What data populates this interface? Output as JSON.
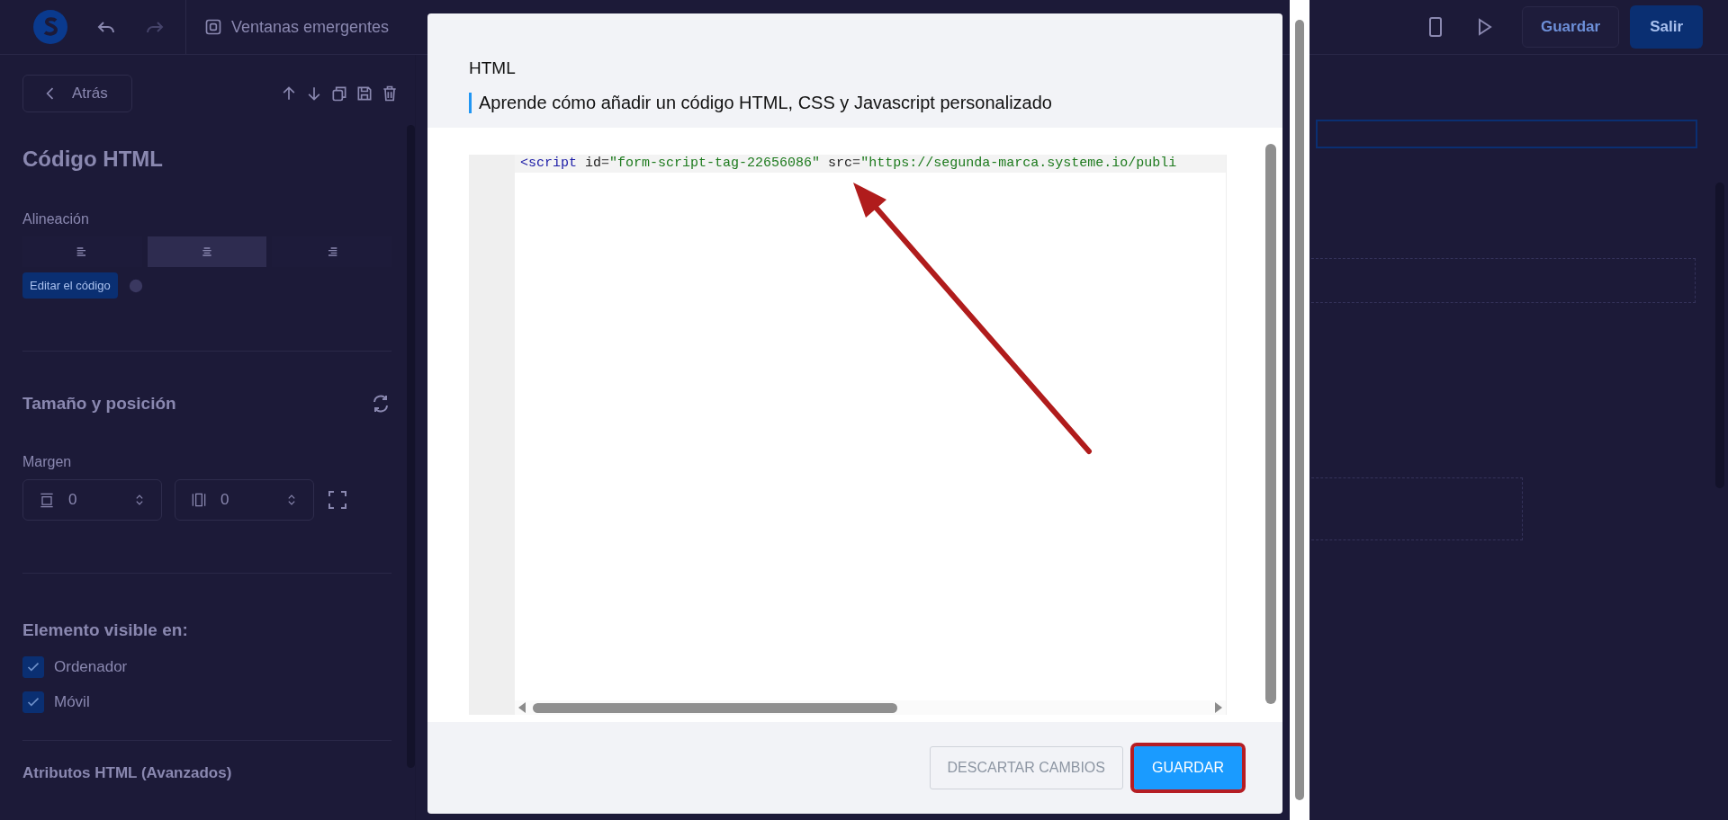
{
  "topbar": {
    "section": "Ventanas emergentes",
    "save": "Guardar",
    "exit": "Salir"
  },
  "sidebar": {
    "back": "Atrás",
    "title": "Código HTML",
    "alignment_label": "Alineación",
    "alignment": [
      {
        "kind": "left",
        "selected": false
      },
      {
        "kind": "center",
        "selected": true
      },
      {
        "kind": "right",
        "selected": false
      }
    ],
    "edit_code": "Editar el código",
    "size_title": "Tamaño y posición",
    "margin_label": "Margen",
    "margins": [
      "0",
      "0"
    ],
    "visible_title": "Elemento visible en:",
    "devices": [
      {
        "label": "Ordenador",
        "checked": true
      },
      {
        "label": "Móvil",
        "checked": true
      }
    ],
    "advanced_title": "Atributos HTML (Avanzados)"
  },
  "modal": {
    "title": "HTML",
    "help_link": "Aprende cómo añadir un código HTML, CSS y Javascript personalizado",
    "code_line": [
      {
        "kind": "tag",
        "text": "<script"
      },
      {
        "kind": "attr",
        "text": " id"
      },
      {
        "kind": "punct",
        "text": "="
      },
      {
        "kind": "string",
        "text": "\"form-script-tag-22656086\""
      },
      {
        "kind": "attr",
        "text": " src"
      },
      {
        "kind": "punct",
        "text": "="
      },
      {
        "kind": "string",
        "text": "\"https://segunda-marca.systeme.io/publi"
      }
    ],
    "buttons": [
      {
        "label": "DESCARTAR CAMBIOS",
        "kind": "secondary",
        "highlighted": false
      },
      {
        "label": "GUARDAR",
        "kind": "primary",
        "highlighted": true
      }
    ]
  }
}
